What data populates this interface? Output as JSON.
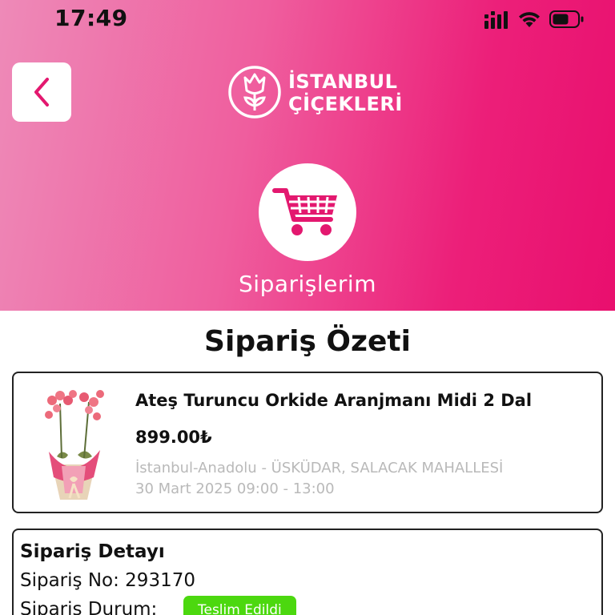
{
  "status_bar": {
    "time": "17:49"
  },
  "header": {
    "brand_line1": "İSTANBUL",
    "brand_line2": "ÇİÇEKLERİ",
    "section_title": "Siparişlerim"
  },
  "summary": {
    "title": "Sipariş Özeti"
  },
  "product": {
    "name": "Ateş Turuncu Orkide Aranjmanı Midi 2 Dal",
    "price": "899.00₺",
    "location": "İstanbul-Anadolu - ÜSKÜDAR, SALACAK MAHALLESİ",
    "date": "30 Mart 2025 09:00 - 13:00"
  },
  "detail": {
    "title": "Sipariş Detayı",
    "order_no_label": "Sipariş No:",
    "order_no": "293170",
    "status_label": "Sipariş Durum:",
    "status_value": "Teslim Edildi"
  },
  "colors": {
    "brand_pink": "#ec1f79",
    "status_green": "#4cd80f"
  },
  "icons": [
    "back-icon",
    "tulip-logo-icon",
    "shopping-cart-icon",
    "cellular-signal-icon",
    "wifi-icon",
    "battery-icon"
  ]
}
